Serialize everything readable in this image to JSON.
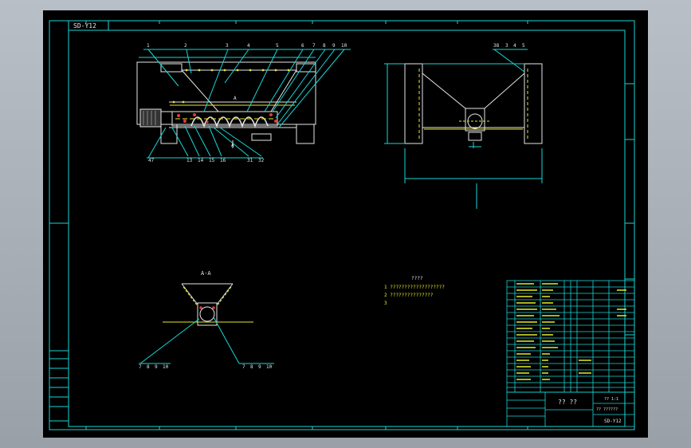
{
  "drawing": {
    "sheet_code": "SD-Y12",
    "section_label": "A-A",
    "section_mark": "A",
    "notes_title": "????",
    "notes": [
      "1 ???????????????????",
      "2 ???????????????",
      "3"
    ],
    "top_balloons": [
      "1",
      "2",
      "3",
      "4",
      "5",
      "6",
      "7",
      "8",
      "9",
      "10"
    ],
    "bottom_balloons": [
      "47",
      "13",
      "14",
      "15",
      "16",
      "31",
      "32"
    ],
    "side_balloons": [
      "38",
      "3",
      "4",
      "5"
    ],
    "section_balloons_left": [
      "7",
      "8",
      "9",
      "10"
    ],
    "section_balloons_right": [
      "7",
      "8",
      "9",
      "10"
    ]
  },
  "title_block": {
    "main_title": "?? ??",
    "subtitle": "?? ??????",
    "drawing_no": "SD-Y12",
    "scale_label": "?? 1:1"
  },
  "icons": [
    "border-frame",
    "zone-ticks",
    "gear-motor",
    "screw-conveyor",
    "hopper"
  ]
}
